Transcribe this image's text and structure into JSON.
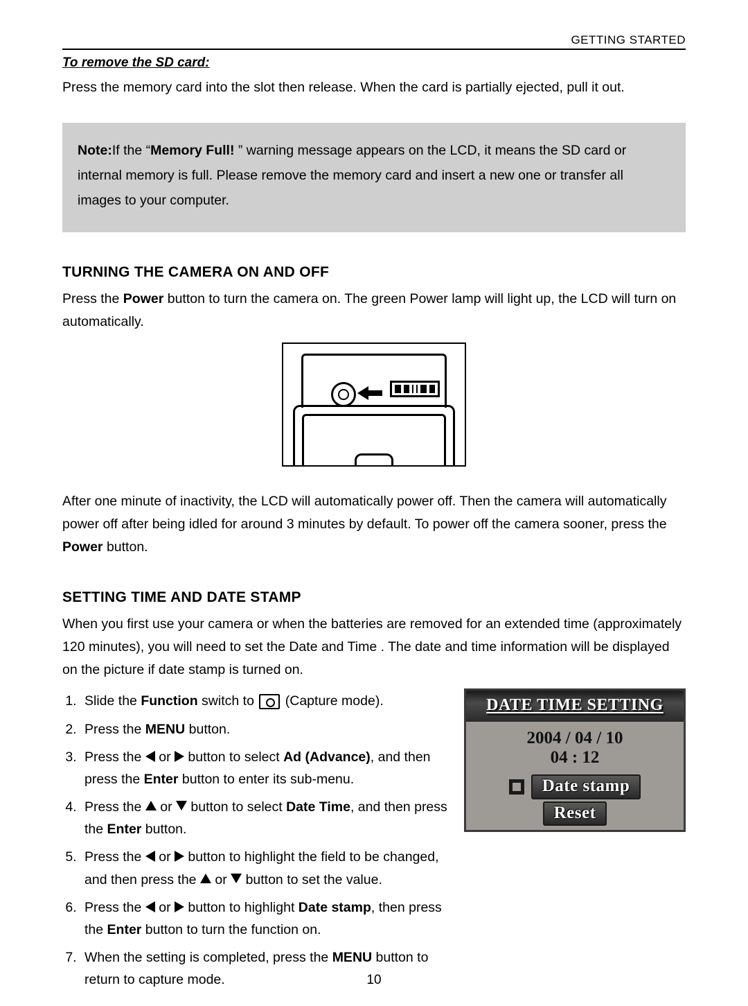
{
  "header": {
    "section": "GETTING STARTED"
  },
  "sd": {
    "heading": "To remove the SD card:",
    "text": "Press the memory card into the slot then release. When the card is partially ejected, pull it out."
  },
  "note": {
    "label": "Note:",
    "bold_msg": "Memory Full! ",
    "pre": "If the “",
    "post": "” warning message appears on the LCD, it means the SD card or internal memory is full. Please remove the memory card and insert a new one or transfer all images to your computer."
  },
  "power": {
    "heading": "TURNING THE CAMERA ON AND OFF",
    "p1a": "Press the ",
    "p1b": "Power",
    "p1c": " button to turn the camera on. The green Power lamp will light up, the LCD will turn on automatically.",
    "p2a": "After one minute of  inactivity, the LCD will automatically power off. Then the camera will automatically power off after being idled for around 3 minutes by default. To power off the camera sooner, press the ",
    "p2b": "Power",
    "p2c": " button."
  },
  "dt": {
    "heading": "SETTING TIME AND DATE STAMP",
    "intro": "When you first use your camera or when the batteries are removed for an extended time (approximately 120 minutes), you will need to set the Date and Time . The date and time information will be displayed on the picture if date stamp is turned on.",
    "s1a": "Slide the ",
    "s1b": "Function",
    "s1c": " switch to ",
    "s1d": " (Capture mode).",
    "s2a": "Press the ",
    "s2b": "MENU",
    "s2c": " button.",
    "s3a": "Press the ",
    "s3or": " or ",
    "s3b": " button to select ",
    "s3bold": "Ad (Advance)",
    "s3c": ", and then press the ",
    "s3enter": "Enter",
    "s3d": " button to enter its sub-menu.",
    "s4a": "Press the ",
    "s4or": " or ",
    "s4b": " button to select ",
    "s4bold": "Date Time",
    "s4c": ", and then press the ",
    "s4enter": "Enter",
    "s4d": " button.",
    "s5a": "Press the ",
    "s5or": " or ",
    "s5b": " button to highlight the field to be changed, and then press the ",
    "s5or2": " or ",
    "s5c": " button to set the value.",
    "s6a": "Press the ",
    "s6or": " or ",
    "s6b": " button to highlight ",
    "s6bold": "Date stamp",
    "s6c": ", then press the ",
    "s6enter": "Enter",
    "s6d": " button to turn the function on.",
    "s7a": "When the setting is completed, press the ",
    "s7bold": "MENU",
    "s7b": " button to return to capture mode."
  },
  "lcd": {
    "title": "DATE TIME SETTING",
    "date": "2004 / 04 / 10",
    "time": "04 : 12",
    "stamp": "Date stamp",
    "reset": "Reset"
  },
  "page_number": "10"
}
